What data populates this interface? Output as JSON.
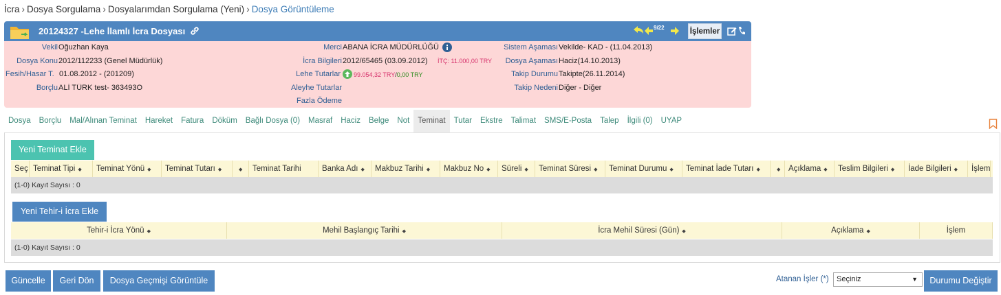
{
  "breadcrumb": {
    "items": [
      "İcra",
      "Dosya Sorgulama",
      "Dosyalarımdan Sorgulama (Yeni)"
    ],
    "current": "Dosya Görüntüleme",
    "separator": "›"
  },
  "file": {
    "title": "20124327 -Lehe İlamlı İcra Dosyası",
    "nav_count": "9/22",
    "islemler_label": "İşlemler"
  },
  "details": {
    "vekil_label": "Vekil",
    "vekil_value": "Oğuzhan Kaya",
    "dosya_konu_label": "Dosya Konu",
    "dosya_konu_value": "2012/112233 (Genel Müdürlük)",
    "fesih_label": "Fesih/Hasar T.",
    "fesih_value": "01.08.2012 - (201209)",
    "borclu_label": "Borçlu",
    "borclu_value": "ALİ TÜRK test- 363493O",
    "merci_label": "Merci",
    "merci_value": "ABANA İCRA MÜDÜRLÜĞÜ",
    "icra_bilgileri_label": "İcra Bilgileri",
    "icra_bilgileri_value": "2012/65465 (03.09.2012)",
    "itc_value": "İTÇ: 11.000,00 TRY",
    "lehe_label": "Lehe Tutarlar",
    "lehe_red": "99.054,32 TRY",
    "lehe_sep": "/",
    "lehe_green": "0,00 TRY",
    "aleyhe_label": "Aleyhe Tutarlar",
    "fazla_label": "Fazla Ödeme",
    "sistem_label": "Sistem Aşaması",
    "sistem_value": "Vekilde- KAD - (11.04.2013)",
    "dosya_asama_label": "Dosya Aşaması",
    "dosya_asama_value": "Haciz(14.10.2013)",
    "takip_durum_label": "Takip Durumu",
    "takip_durum_value": "Takipte(26.11.2014)",
    "takip_neden_label": "Takip Nedeni",
    "takip_neden_value": "Diğer - Diğer"
  },
  "tabs": [
    "Dosya",
    "Borçlu",
    "Mal/Alınan Teminat",
    "Hareket",
    "Fatura",
    "Döküm",
    "Bağlı Dosya (0)",
    "Masraf",
    "Haciz",
    "Belge",
    "Not",
    "Teminat",
    "Tutar",
    "Ekstre",
    "Talimat",
    "SMS/E-Posta",
    "Talep",
    "İlgili (0)",
    "UYAP"
  ],
  "active_tab": "Teminat",
  "teminat": {
    "add_button": "Yeni Teminat Ekle",
    "columns": [
      "Seç",
      "Teminat Tipi",
      "Teminat Yönü",
      "Teminat Tutarı",
      "",
      "Teminat Tarihi",
      "Banka Adı",
      "Makbuz Tarihi",
      "Makbuz No",
      "Süreli",
      "Teminat Süresi",
      "Teminat Durumu",
      "Teminat İade Tutarı",
      "",
      "Açıklama",
      "Teslim Bilgileri",
      "İade Bilgileri",
      "İşlem"
    ],
    "record_count": "(1-0) Kayıt Sayısı : 0"
  },
  "tehir": {
    "add_button": "Yeni Tehir-i İcra Ekle",
    "columns": [
      "Tehir-i İcra Yönü",
      "Mehil Başlangıç Tarihi",
      "İcra Mehil Süresi (Gün)",
      "Açıklama",
      "İşlem"
    ],
    "record_count": "(1-0) Kayıt Sayısı : 0"
  },
  "bottom": {
    "guncelle": "Güncelle",
    "geri_don": "Geri Dön",
    "gecmis": "Dosya Geçmişi Görüntüle",
    "atanan_label": "Atanan İşler (*)",
    "select_value": "Seçiniz",
    "durum_button": "Durumu Değiştir"
  },
  "colors": {
    "header_blue": "#4f86c0",
    "panel_pink": "#fdd7d7",
    "teal": "#4cc3b0",
    "table_head": "#fcf7d6"
  }
}
